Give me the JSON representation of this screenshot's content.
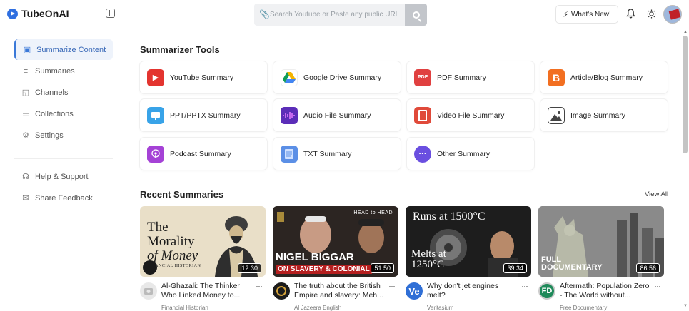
{
  "app": {
    "name": "TubeOnAI"
  },
  "search": {
    "placeholder": "Search Youtube or Paste any public URL"
  },
  "header": {
    "whats_new": "What's New!"
  },
  "sidebar": {
    "items": [
      {
        "label": "Summarize Content",
        "icon": "robot-icon",
        "active": true
      },
      {
        "label": "Summaries",
        "icon": "list-icon"
      },
      {
        "label": "Channels",
        "icon": "channel-icon"
      },
      {
        "label": "Collections",
        "icon": "collection-icon"
      },
      {
        "label": "Settings",
        "icon": "gear-icon"
      }
    ],
    "footer_items": [
      {
        "label": "Help & Support",
        "icon": "headset-icon"
      },
      {
        "label": "Share Feedback",
        "icon": "megaphone-icon"
      }
    ]
  },
  "main": {
    "tools_title": "Summarizer Tools",
    "tools": [
      {
        "label": "YouTube Summary",
        "icon": "youtube-icon",
        "color": "#e3342f"
      },
      {
        "label": "Google Drive Summary",
        "icon": "google-drive-icon",
        "color": "#f4b400"
      },
      {
        "label": "PDF Summary",
        "icon": "pdf-icon",
        "color": "#e04040"
      },
      {
        "label": "Article/Blog Summary",
        "icon": "blogger-icon",
        "color": "#f26f21"
      },
      {
        "label": "PPT/PPTX Summary",
        "icon": "presentation-icon",
        "color": "#38a3e8"
      },
      {
        "label": "Audio File Summary",
        "icon": "audio-wave-icon",
        "color": "#5b2db8"
      },
      {
        "label": "Video File Summary",
        "icon": "film-icon",
        "color": "#e04a3a"
      },
      {
        "label": "Image Summary",
        "icon": "image-icon",
        "color": "#444444"
      },
      {
        "label": "Podcast Summary",
        "icon": "podcast-icon",
        "color": "#a542d6"
      },
      {
        "label": "TXT Summary",
        "icon": "txt-file-icon",
        "color": "#5b8fe6"
      },
      {
        "label": "Other Summary",
        "icon": "more-dots-icon",
        "color": "#6a4fe0"
      }
    ],
    "recent_title": "Recent Summaries",
    "view_all": "View All",
    "videos": [
      {
        "title": "Al-Ghazali: The Thinker Who Linked Money to...",
        "channel": "Financial Historian",
        "duration": "12:30"
      },
      {
        "title": "The truth about the British Empire and slavery: Meh...",
        "channel": "Al Jazeera English",
        "duration": "51:50"
      },
      {
        "title": "Why don't jet engines melt?",
        "channel": "Veritasium",
        "duration": "39:34"
      },
      {
        "title": "Aftermath: Population Zero - The World without...",
        "channel": "Free Documentary",
        "duration": "86:56"
      }
    ],
    "thumbnails": [
      {
        "line1": "The",
        "line2": "Morality",
        "line3": "of Money",
        "line4": "FINANCIAL HISTORIAN"
      },
      {
        "line1": "HEAD to HEAD",
        "line2": "NIGEL BIGGAR",
        "line3": "ON SLAVERY & COLONIAL"
      },
      {
        "line1": "Runs at 1500°C",
        "line2": "Melts at",
        "line3": "1250°C"
      },
      {
        "line1": "FULL",
        "line2": "DOCUMENTARY"
      }
    ]
  }
}
